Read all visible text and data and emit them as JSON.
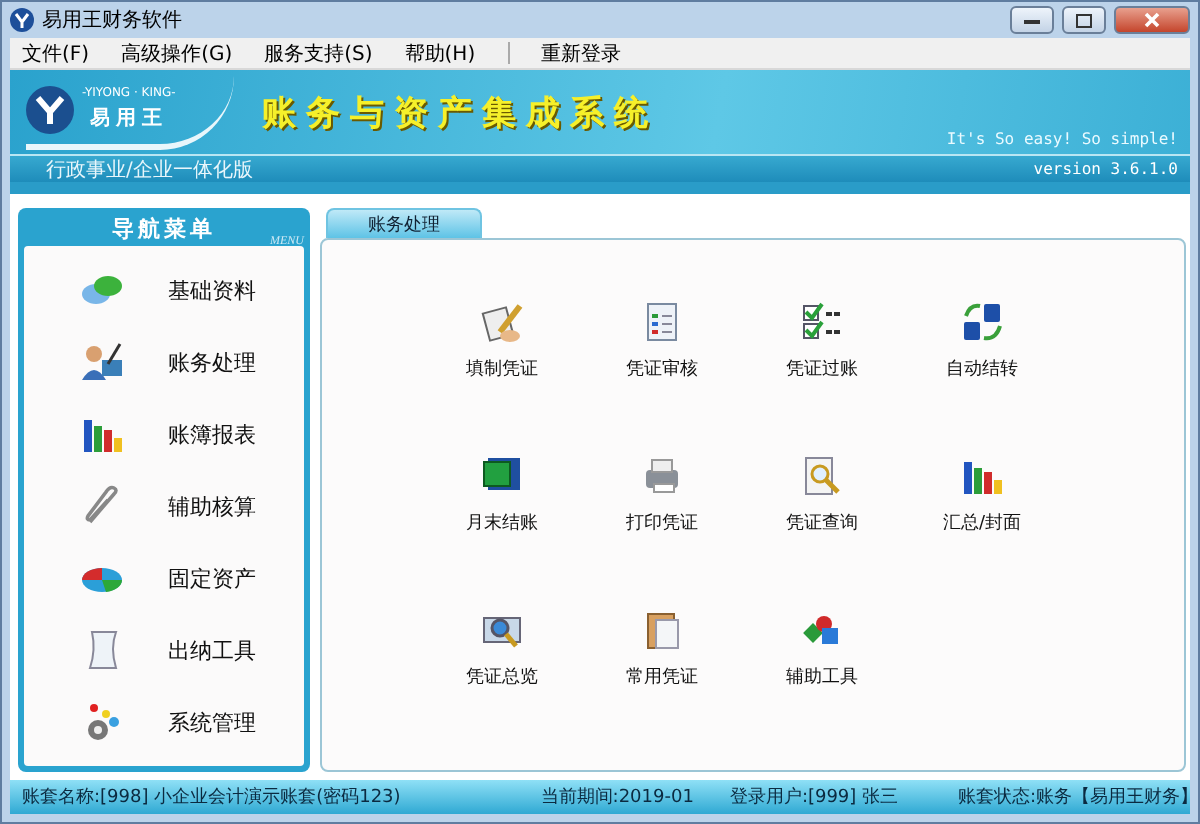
{
  "window": {
    "title": "易用王财务软件"
  },
  "menu": [
    {
      "label": "文件(F)"
    },
    {
      "label": "高级操作(G)"
    },
    {
      "label": "服务支持(S)"
    },
    {
      "label": "帮助(H)"
    },
    {
      "label": "重新登录"
    }
  ],
  "banner": {
    "logo_top": "-YIYONG · KING-",
    "logo_name": "易用王",
    "system_title": "账务与资产集成系统",
    "slogan": "It's So easy! So simple!",
    "edition": "行政事业/企业一体化版",
    "version": "version 3.6.1.0"
  },
  "nav": {
    "title": "导航菜单",
    "subtitle": "MENU",
    "items": [
      {
        "label": "基础资料"
      },
      {
        "label": "账务处理"
      },
      {
        "label": "账簿报表"
      },
      {
        "label": "辅助核算"
      },
      {
        "label": "固定资产"
      },
      {
        "label": "出纳工具"
      },
      {
        "label": "系统管理"
      }
    ]
  },
  "tabs": [
    {
      "label": "账务处理",
      "selected": true
    }
  ],
  "functions": [
    {
      "label": "填制凭证"
    },
    {
      "label": "凭证审核"
    },
    {
      "label": "凭证过账"
    },
    {
      "label": "自动结转"
    },
    {
      "label": "月末结账"
    },
    {
      "label": "打印凭证"
    },
    {
      "label": "凭证查询"
    },
    {
      "label": "汇总/封面"
    },
    {
      "label": "凭证总览"
    },
    {
      "label": "常用凭证"
    },
    {
      "label": "辅助工具"
    }
  ],
  "status_bar": {
    "account": "账套名称:[998] 小企业会计演示账套(密码123)",
    "period": "当前期间:2019-01",
    "user": "登录用户:[999] 张三",
    "state": "账套状态:账务",
    "brand": "【易用王财务】"
  }
}
